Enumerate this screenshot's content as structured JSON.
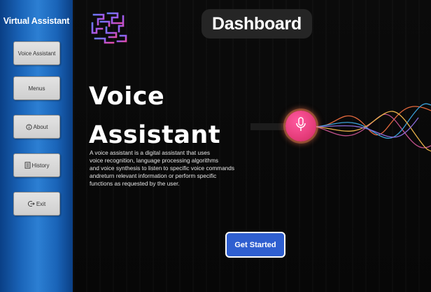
{
  "sidebar": {
    "title": "Virtual Assistant",
    "items": [
      {
        "label": "Voice Assistant",
        "icon": ""
      },
      {
        "label": "Menus",
        "icon": ""
      },
      {
        "label": "About",
        "icon": "info-icon"
      },
      {
        "label": "History",
        "icon": "history-icon"
      },
      {
        "label": "Exit",
        "icon": "exit-icon"
      }
    ]
  },
  "header": {
    "title": "Dashboard"
  },
  "hero": {
    "title_line1": "Voice",
    "title_line2": "Assistant",
    "description_lines": [
      "A voice assistant is a digital assistant that uses",
      "voice recognition, language processing algorithms",
      "and voice synthesis to listen to specific voice commands",
      "andreturn relevant information or perform specific",
      "functions as requested by the user."
    ]
  },
  "actions": {
    "get_started_label": "Get Started"
  },
  "colors": {
    "sidebar_blue": "#1a64b8",
    "background": "#0a0a0a",
    "title_pill": "#252525",
    "mic_pink": "#e63d7b",
    "button_blue": "#2f5fd0"
  },
  "icons": {
    "logo": "hexagon-knot-logo",
    "mic": "microphone-icon"
  }
}
